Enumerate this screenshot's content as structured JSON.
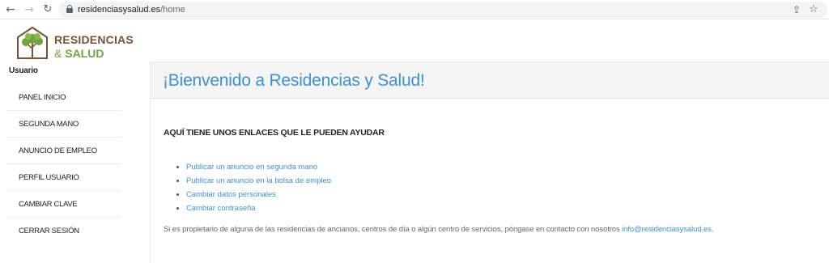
{
  "browser": {
    "url_domain": "residenciasysalud.es",
    "url_path": "/home"
  },
  "logo": {
    "line1": "RESIDENCIAS",
    "ampersand": "&",
    "line2": "SALUD"
  },
  "sidebar": {
    "section_label": "Usuario",
    "items": [
      {
        "label": "PANEL INICIO"
      },
      {
        "label": "SEGUNDA MANO"
      },
      {
        "label": "ANUNCIO DE EMPLEO"
      },
      {
        "label": "PERFIL USUARIO"
      },
      {
        "label": "CAMBIAR CLAVE"
      },
      {
        "label": "CERRAR SESIÓN"
      }
    ]
  },
  "main": {
    "title": "¡Bienvenido a Residencias y Salud!",
    "help_heading": "AQUÍ TIENE UNOS ENLACES QUE LE PUEDEN AYUDAR",
    "links": [
      {
        "label": "Publicar un anuncio en segunda mano"
      },
      {
        "label": "Publicar un anuncio en la bolsa de empleo"
      },
      {
        "label": "Cambiar datos personales"
      },
      {
        "label": "Cambiar contraseña"
      }
    ],
    "owner_note": "Si es propietario de alguna de las residencias de ancianos, centros de día o algún centro de servicios, póngase en contacto con nosotros ",
    "owner_email": "info@residenciasysalud.es",
    "owner_note_end": "."
  },
  "colors": {
    "accent": "#3f90d3",
    "brand_brown": "#7a5236",
    "brand_green": "#74a23e"
  },
  "icons": [
    "back-icon",
    "forward-icon",
    "reload-icon",
    "lock-icon",
    "share-icon",
    "star-icon",
    "logo-house-tree-icon"
  ]
}
